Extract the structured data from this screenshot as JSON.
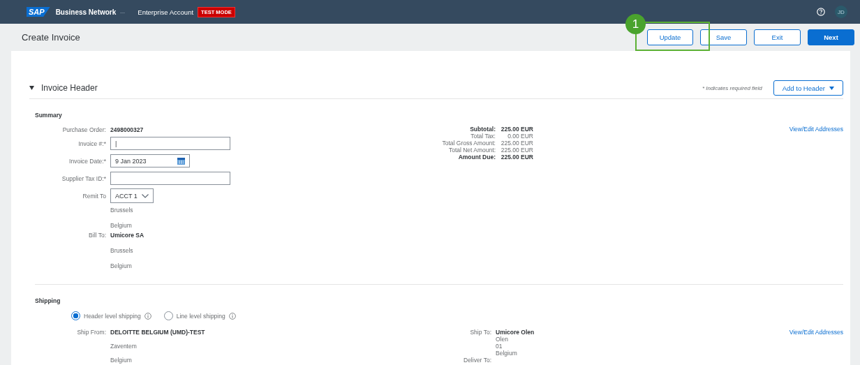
{
  "topbar": {
    "logo": "SAP",
    "product": "Business Network",
    "account": "Enterprise Account",
    "badge": "TEST MODE",
    "user_initials": "JD"
  },
  "header": {
    "title": "Create Invoice",
    "buttons": [
      {
        "label": "Update",
        "primary": false
      },
      {
        "label": "Save",
        "primary": false
      },
      {
        "label": "Exit",
        "primary": false
      },
      {
        "label": "Next",
        "primary": true
      }
    ]
  },
  "callout": {
    "number": "1"
  },
  "section": {
    "title": "Invoice Header",
    "expanded": true,
    "required_note": "* Indicates required field",
    "add_button": "Add to Header"
  },
  "summary": {
    "title": "Summary",
    "rows": [
      {
        "kind": "text",
        "label": "Purchase Order:",
        "value": "2498000327"
      },
      {
        "kind": "input",
        "label": "Invoice #:*",
        "value": "|"
      },
      {
        "kind": "date",
        "label": "Invoice Date:*",
        "value": "9 Jan 2023"
      },
      {
        "kind": "input",
        "label": "Supplier Tax ID:*",
        "value": ""
      },
      {
        "kind": "select",
        "label": "Remit To",
        "value": "ACCT 1"
      },
      {
        "kind": "line",
        "label": "",
        "value": "Brussels"
      },
      {
        "kind": "line",
        "label": "",
        "value": "Belgium"
      },
      {
        "kind": "bold",
        "label": "Bill To:",
        "value": "Umicore SA"
      },
      {
        "kind": "line",
        "label": "",
        "value": "Brussels"
      },
      {
        "kind": "line",
        "label": "",
        "value": "Belgium"
      }
    ],
    "totals": [
      {
        "label": "Subtotal:",
        "value": "225.00 EUR",
        "bold": true
      },
      {
        "label": "Total Tax:",
        "value": "0.00 EUR",
        "bold": false
      },
      {
        "label": "Total Gross Amount:",
        "value": "225.00 EUR",
        "bold": false
      },
      {
        "label": "Total Net Amount:",
        "value": "225.00 EUR",
        "bold": false
      },
      {
        "label": "Amount Due:",
        "value": "225.00 EUR",
        "bold": true
      }
    ],
    "link": "View/Edit Addresses"
  },
  "shipping": {
    "title": "Shipping",
    "options": [
      {
        "label": "Header level shipping",
        "selected": true
      },
      {
        "label": "Line level shipping",
        "selected": false
      }
    ],
    "ship_from": {
      "label": "Ship From:",
      "lines": [
        "DELOITTE BELGIUM (UMD)-TEST",
        "Zaventem",
        "Belgium"
      ]
    },
    "ship_to": {
      "label": "Ship To:",
      "lines": [
        "Umicore Olen",
        "Olen",
        "01",
        "Belgium"
      ]
    },
    "deliver_to": {
      "label": "Deliver To:"
    },
    "link": "View/Edit Addresses"
  }
}
